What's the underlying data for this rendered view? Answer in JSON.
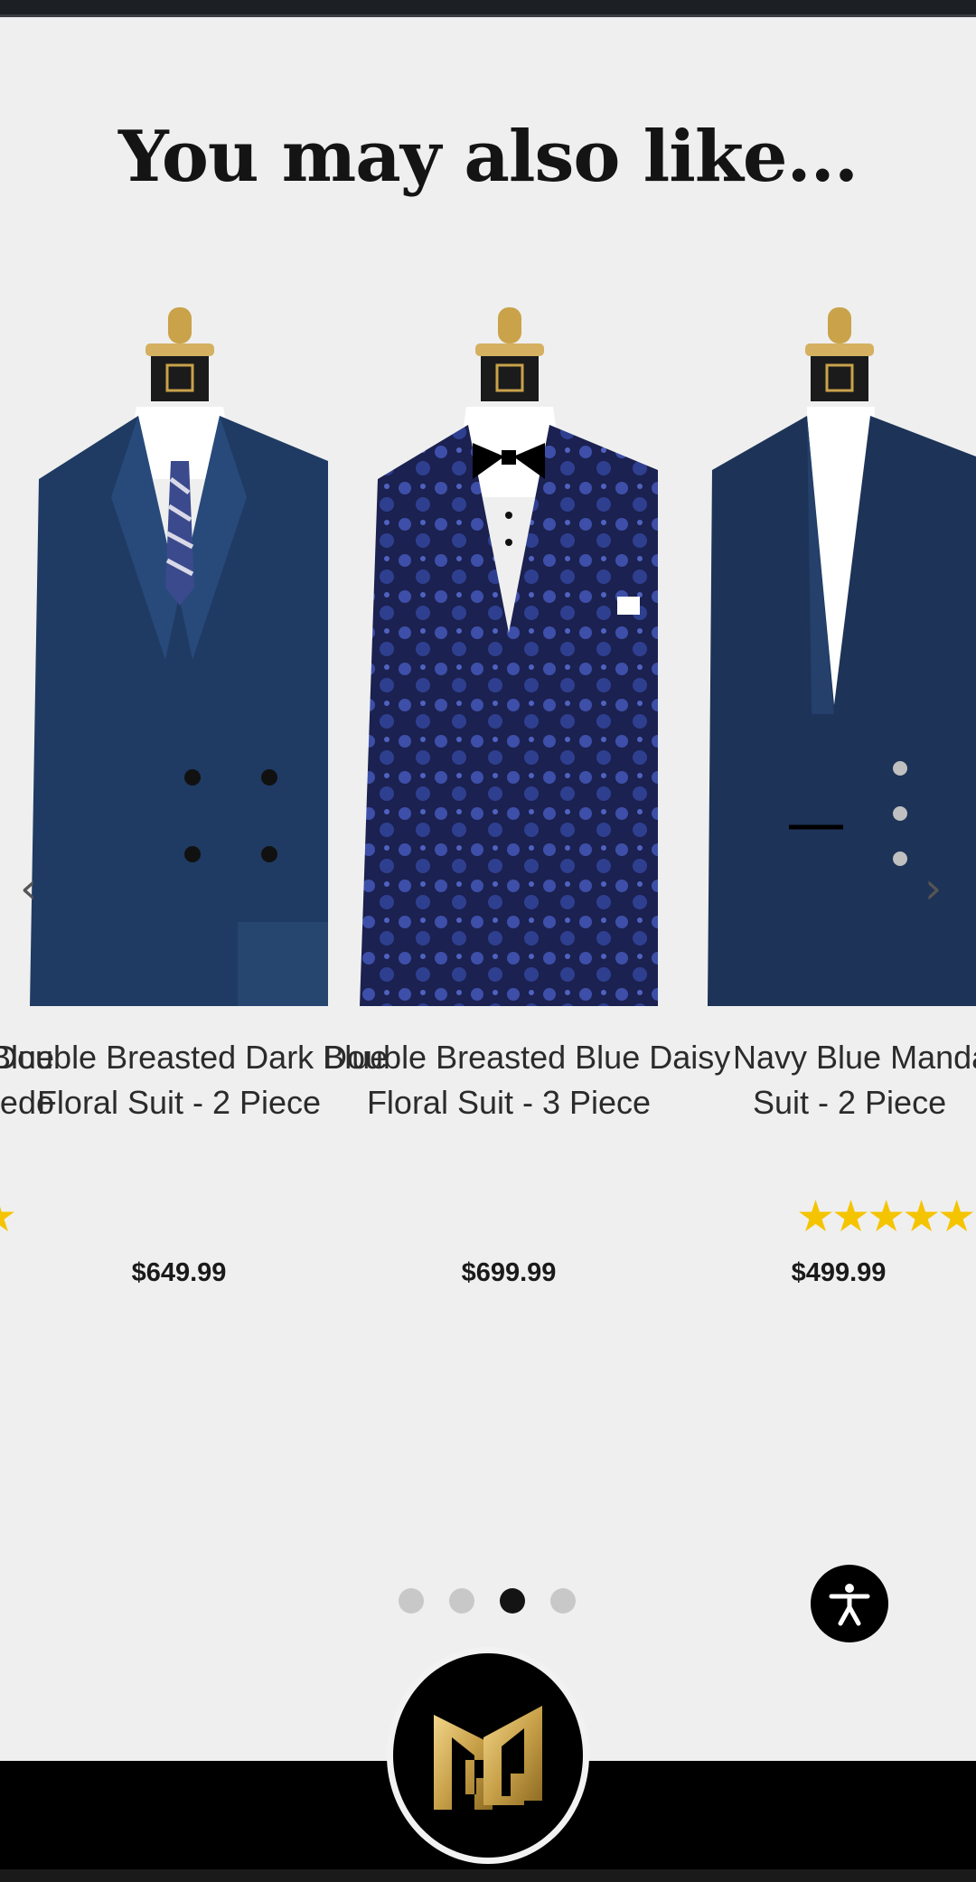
{
  "section": {
    "title": "You may also like..."
  },
  "products": [
    {
      "title_lines": [
        "Blue",
        "xedo"
      ],
      "rating_stars": "★",
      "price": ""
    },
    {
      "title_lines": [
        "Double Breasted Dark Blue",
        "Floral Suit - 2 Piece"
      ],
      "rating_stars": "",
      "price": "$649.99"
    },
    {
      "title_lines": [
        "Double Breasted Blue Daisy",
        "Floral Suit - 3 Piece"
      ],
      "rating_stars": "",
      "price": "$699.99"
    },
    {
      "title_lines": [
        "Navy Blue Mandarin",
        "Suit - 2 Piece"
      ],
      "rating_stars": "★★★★★",
      "price": "$499.99"
    }
  ],
  "carousel": {
    "prev_icon": "chevron-left-icon",
    "next_icon": "chevron-right-icon",
    "page_count": 4,
    "active_page": 3
  },
  "colors": {
    "accent_gold": "#c9a24a",
    "star": "#f5c400",
    "suit_navy": "#1f3b63",
    "suit_blue": "#2c3f8a"
  },
  "accessibility_icon": "accessibility-icon",
  "footer": {
    "logo_icon": "brand-logo-icon"
  }
}
